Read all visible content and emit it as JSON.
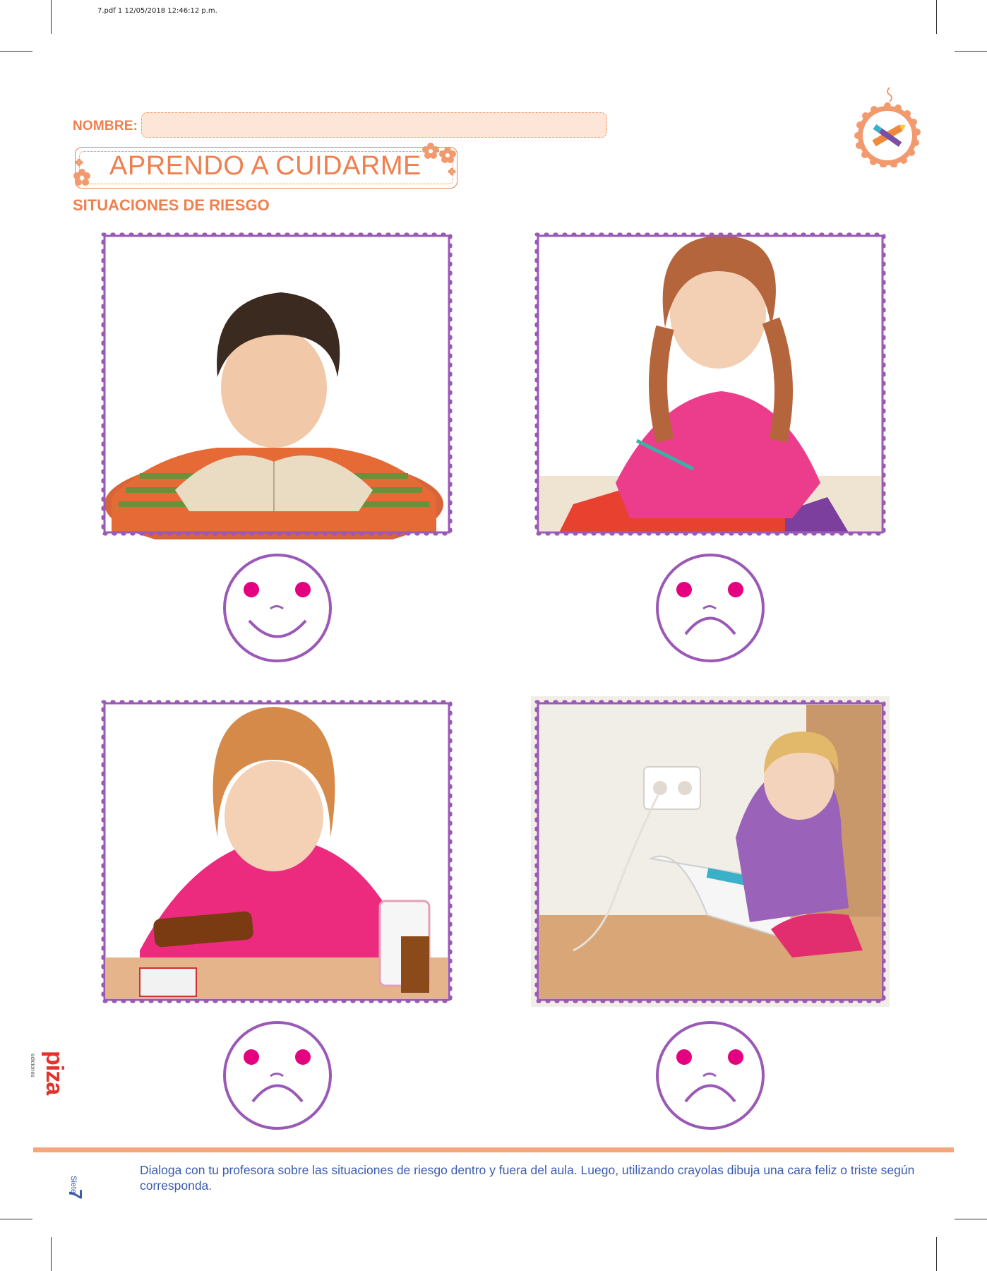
{
  "pdf_meta": "7.pdf   1   12/05/2018   12:46:12 p.m.",
  "header": {
    "name_label": "NOMBRE:",
    "title": "APRENDO A CUIDARME",
    "subtitle": "SITUACIONES DE RIESGO"
  },
  "activities": [
    {
      "image": "boy-reading-book",
      "face": "happy"
    },
    {
      "image": "girl-cutting-paper-with-scissors",
      "face": "sad"
    },
    {
      "image": "girl-pouring-medicine",
      "face": "sad"
    },
    {
      "image": "toddler-unplugging-iron-from-outlet",
      "face": "sad"
    }
  ],
  "footer": {
    "instruction": "Dialoga con tu profesora sobre las situaciones de riesgo dentro y fuera del aula. Luego, utilizando crayolas dibuja una cara feliz o triste según corresponda.",
    "page_number": "7",
    "page_word": "Siete",
    "publisher": "piza",
    "publisher_sub": "ediciones"
  },
  "colors": {
    "accent_orange": "#ef7f4f",
    "frame_purple": "#9b59b6",
    "face_dots": "#e4007f",
    "text_blue": "#3b5bab"
  }
}
